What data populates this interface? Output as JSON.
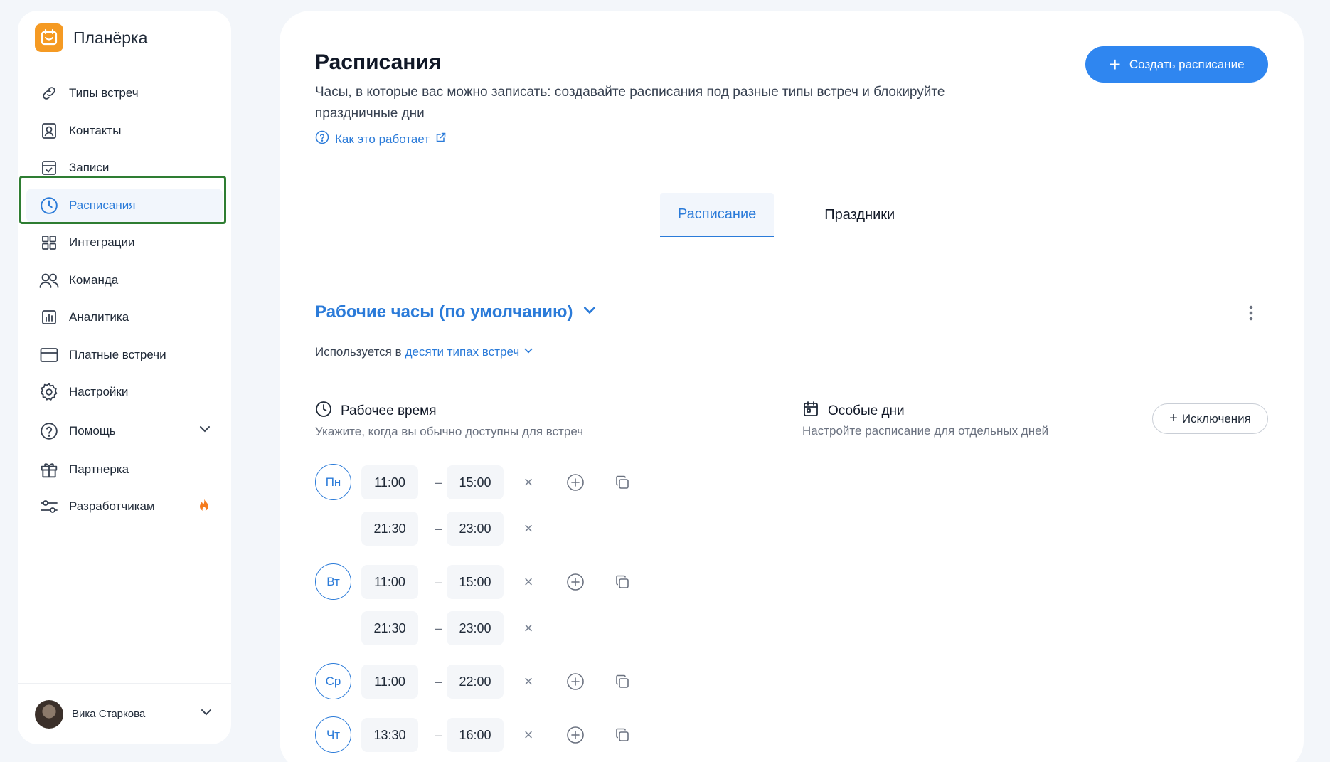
{
  "app": {
    "name": "Планёрка",
    "brand_color": "#f59a23",
    "accent_color": "#2f86f0"
  },
  "sidebar": {
    "items": [
      {
        "label": "Типы встреч",
        "icon": "link-icon"
      },
      {
        "label": "Контакты",
        "icon": "contact-icon"
      },
      {
        "label": "Записи",
        "icon": "calendar-check-icon"
      },
      {
        "label": "Расписания",
        "icon": "clock-icon",
        "active": true
      },
      {
        "label": "Интеграции",
        "icon": "grid-icon"
      },
      {
        "label": "Команда",
        "icon": "users-icon"
      },
      {
        "label": "Аналитика",
        "icon": "chart-icon"
      },
      {
        "label": "Платные встречи",
        "icon": "card-icon"
      },
      {
        "label": "Настройки",
        "icon": "gear-icon"
      },
      {
        "label": "Помощь",
        "icon": "help-icon"
      },
      {
        "label": "Партнерка",
        "icon": "gift-icon"
      },
      {
        "label": "Разработчикам",
        "icon": "sliders-icon"
      }
    ],
    "user": {
      "name": "Вика Старкова"
    }
  },
  "main": {
    "title": "Расписания",
    "description": "Часы, в которые вас можно записать: создавайте расписания под разные типы встреч и блокируйте праздничные дни",
    "help_link": "Как это работает",
    "create_button": "Создать расписание",
    "tabs": [
      {
        "label": "Расписание",
        "active": true
      },
      {
        "label": "Праздники",
        "active": false
      }
    ],
    "schedule": {
      "name": "Рабочие часы (по умолчанию)",
      "used_in_prefix": "Используется в",
      "used_in_link": "десяти типах встреч"
    },
    "working_time": {
      "title": "Рабочее время",
      "subtitle": "Укажите, когда вы обычно доступны для встреч"
    },
    "special_days": {
      "title": "Особые дни",
      "subtitle": "Настройте расписание для отдельных дней",
      "exceptions_button": "Исключения"
    },
    "days": [
      {
        "label": "Пн",
        "slots": [
          {
            "from": "11:00",
            "to": "15:00"
          },
          {
            "from": "21:30",
            "to": "23:00"
          }
        ]
      },
      {
        "label": "Вт",
        "slots": [
          {
            "from": "11:00",
            "to": "15:00"
          },
          {
            "from": "21:30",
            "to": "23:00"
          }
        ]
      },
      {
        "label": "Ср",
        "slots": [
          {
            "from": "11:00",
            "to": "22:00"
          }
        ]
      },
      {
        "label": "Чт",
        "slots": [
          {
            "from": "13:30",
            "to": "16:00"
          }
        ]
      }
    ],
    "dash": "–"
  }
}
